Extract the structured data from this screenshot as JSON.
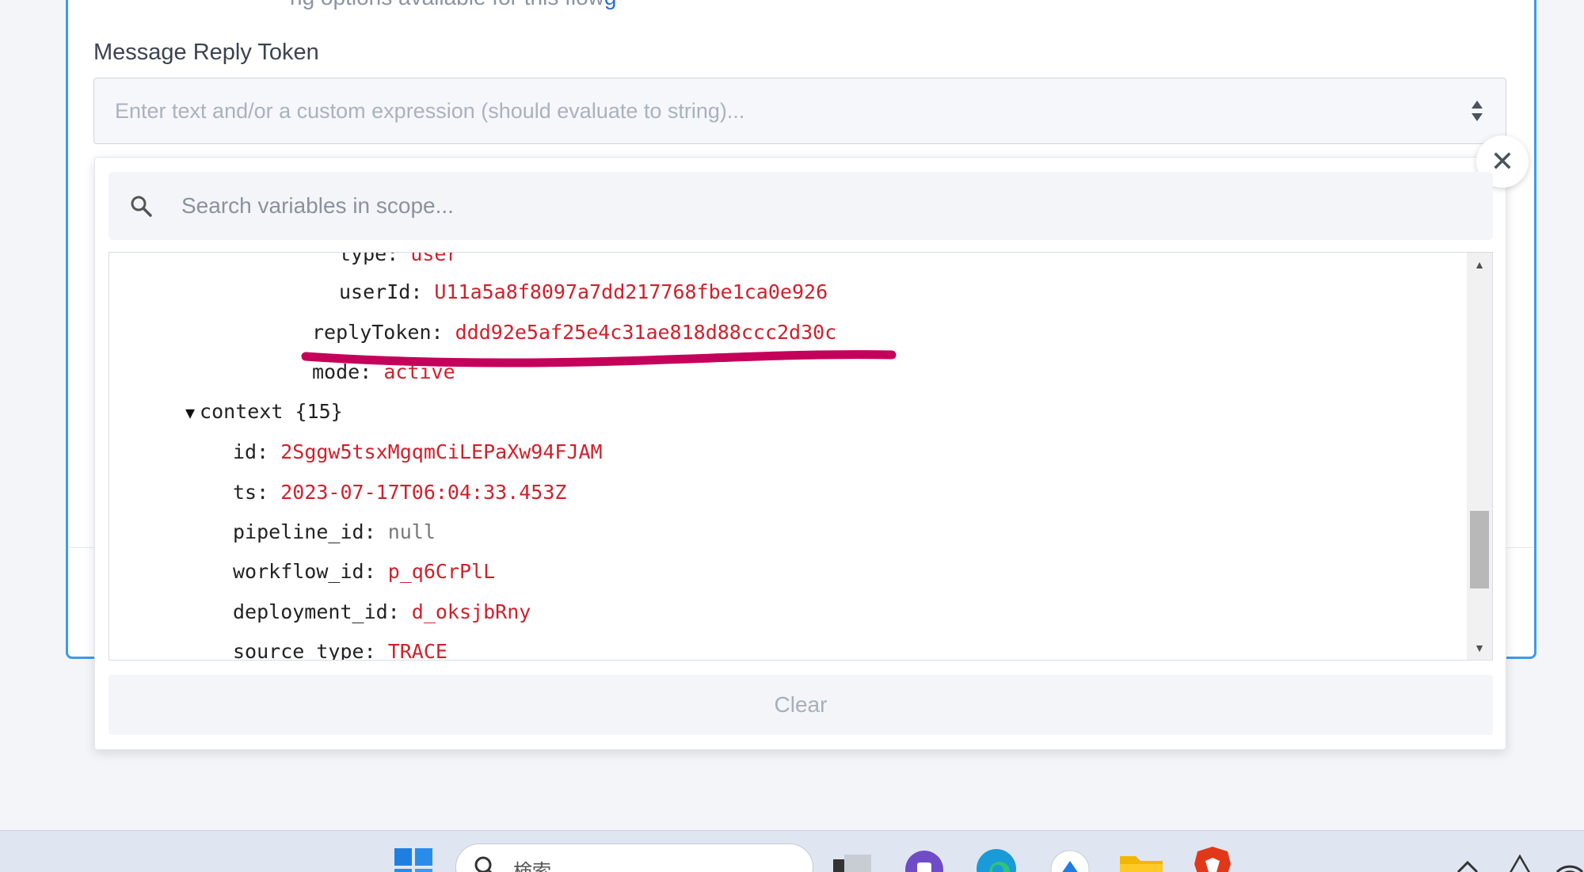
{
  "card": {
    "top_text": "ng options available for this flow",
    "top_link": "g"
  },
  "field": {
    "label": "Message Reply Token",
    "placeholder": "Enter text and/or a custom expression (should evaluate to string)..."
  },
  "variables": {
    "search_placeholder": "Search variables in scope...",
    "close_symbol": "✕",
    "tree": [
      {
        "key": "type",
        "value": "user",
        "kind": "string"
      },
      {
        "key": "userId",
        "value": "U11a5a8f8097a7dd217768fbe1ca0e926",
        "kind": "string"
      },
      {
        "key": "replyToken",
        "value": "ddd92e5af25e4c31ae818d88ccc2d30c",
        "kind": "string"
      },
      {
        "key": "mode",
        "value": "active",
        "kind": "string"
      },
      {
        "key": "context",
        "value": "{15}",
        "kind": "object"
      },
      {
        "key": "id",
        "value": "2Sggw5tsxMgqmCiLEPaXw94FJAM",
        "kind": "string"
      },
      {
        "key": "ts",
        "value": "2023-07-17T06:04:33.453Z",
        "kind": "string"
      },
      {
        "key": "pipeline_id",
        "value": "null",
        "kind": "null"
      },
      {
        "key": "workflow_id",
        "value": "p_q6CrPlL",
        "kind": "string"
      },
      {
        "key": "deployment_id",
        "value": "d_oksjbRny",
        "kind": "string"
      },
      {
        "key": "source_type",
        "value": "TRACE",
        "kind": "string"
      }
    ],
    "clear_label": "Clear",
    "annotation_color": "#c5005a"
  },
  "taskbar": {
    "search_text": "検索",
    "icons": [
      "windows-start-icon",
      "task-view-icon",
      "teams-icon",
      "edge-icon",
      "store-icon",
      "file-explorer-icon",
      "brave-icon",
      "chevron-up-icon",
      "network-icon",
      "wifi-icon"
    ]
  },
  "colors": {
    "accent_blue": "#3d9be9",
    "value_red": "#d0202c",
    "null_gray": "#777777"
  }
}
